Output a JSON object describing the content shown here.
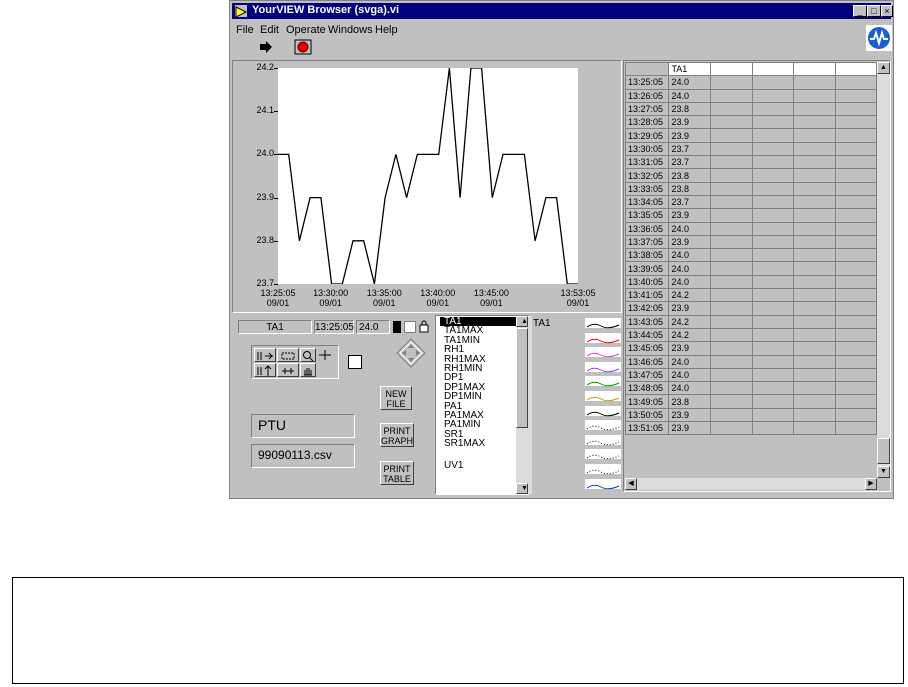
{
  "window": {
    "title": "YourVIEW Browser (svga).vi",
    "controls": [
      "minimize-icon",
      "maximize-icon",
      "close-icon"
    ]
  },
  "menu": [
    "File",
    "Edit",
    "Operate",
    "Windows",
    "Help"
  ],
  "toolbar": {
    "run_icon": "run-arrow-icon",
    "stop_icon": "stop-icon",
    "logo_icon": "vi-logo-icon"
  },
  "chart_data": {
    "type": "line",
    "ylim": [
      23.7,
      24.2
    ],
    "yticks": [
      "24.2",
      "24.1",
      "24.0",
      "23.9",
      "23.8",
      "23.7"
    ],
    "xticks": [
      {
        "time": "13:25:05",
        "date": "09/01"
      },
      {
        "time": "13:30:00",
        "date": "09/01"
      },
      {
        "time": "13:35:00",
        "date": "09/01"
      },
      {
        "time": "13:40:00",
        "date": "09/01"
      },
      {
        "time": "13:45:00",
        "date": "09/01"
      },
      {
        "time": "13:53:05",
        "date": "09/01"
      }
    ],
    "x": [
      "13:25:05",
      "13:26:05",
      "13:27:05",
      "13:28:05",
      "13:29:05",
      "13:30:05",
      "13:31:05",
      "13:32:05",
      "13:33:05",
      "13:34:05",
      "13:35:05",
      "13:36:05",
      "13:37:05",
      "13:38:05",
      "13:39:05",
      "13:40:05",
      "13:41:05",
      "13:42:05",
      "13:43:05",
      "13:44:05",
      "13:45:05",
      "13:46:05",
      "13:47:05",
      "13:48:05",
      "13:49:05",
      "13:50:05",
      "13:51:05",
      "13:52:05",
      "13:53:05"
    ],
    "series": [
      {
        "name": "TA1",
        "values": [
          24.0,
          24.0,
          23.8,
          23.9,
          23.9,
          23.7,
          23.7,
          23.8,
          23.8,
          23.7,
          23.9,
          24.0,
          23.9,
          24.0,
          24.0,
          24.0,
          24.2,
          23.9,
          24.2,
          24.2,
          23.9,
          24.0,
          24.0,
          24.0,
          23.8,
          23.9,
          23.9,
          23.7,
          23.7
        ]
      }
    ]
  },
  "cursor": {
    "channel": "TA1",
    "time": "13:25:05",
    "value": "24.0"
  },
  "tools": [
    "zoom-x-icon",
    "zoom-y-icon",
    "zoom-icon",
    "crosshair-icon",
    "pan-icon",
    "hand-icon"
  ],
  "buttons": {
    "new_file": [
      "NEW",
      "FILE"
    ],
    "print_graph": [
      "PRINT",
      "GRAPH"
    ],
    "print_table": [
      "PRINT",
      "TABLE"
    ]
  },
  "fields": {
    "name": "PTU",
    "file": "99090113.csv"
  },
  "channels": [
    "TA1",
    "TA1MAX",
    "TA1MIN",
    "RH1",
    "RH1MAX",
    "RH1MIN",
    "DP1",
    "DP1MAX",
    "DP1MIN",
    "PA1",
    "PA1MAX",
    "PA1MIN",
    "SR1",
    "SR1MAX",
    "",
    "UV1"
  ],
  "legend": {
    "label": "TA1",
    "swatches": [
      {
        "color": "#000000",
        "style": "solid"
      },
      {
        "color": "#ff0000",
        "style": "solid"
      },
      {
        "color": "#cc44cc",
        "style": "solid"
      },
      {
        "color": "#8844ff",
        "style": "solid"
      },
      {
        "color": "#009900",
        "style": "solid"
      },
      {
        "color": "#cc9900",
        "style": "solid"
      },
      {
        "color": "#000000",
        "style": "solid"
      },
      {
        "color": "#000000",
        "style": "dotted"
      },
      {
        "color": "#000000",
        "style": "dotted"
      },
      {
        "color": "#000000",
        "style": "dotted"
      },
      {
        "color": "#000000",
        "style": "dotted"
      },
      {
        "color": "#0044cc",
        "style": "solid"
      }
    ]
  },
  "table": {
    "header": [
      "",
      "TA1",
      "",
      "",
      "",
      ""
    ],
    "rows": [
      [
        "13:25:05",
        "24.0"
      ],
      [
        "13:26:05",
        "24.0"
      ],
      [
        "13:27:05",
        "23.8"
      ],
      [
        "13:28:05",
        "23.9"
      ],
      [
        "13:29:05",
        "23.9"
      ],
      [
        "13:30:05",
        "23.7"
      ],
      [
        "13:31:05",
        "23.7"
      ],
      [
        "13:32:05",
        "23.8"
      ],
      [
        "13:33:05",
        "23.8"
      ],
      [
        "13:34:05",
        "23.7"
      ],
      [
        "13:35:05",
        "23.9"
      ],
      [
        "13:36:05",
        "24.0"
      ],
      [
        "13:37:05",
        "23.9"
      ],
      [
        "13:38:05",
        "24.0"
      ],
      [
        "13:39:05",
        "24.0"
      ],
      [
        "13:40:05",
        "24.0"
      ],
      [
        "13:41:05",
        "24.2"
      ],
      [
        "13:42:05",
        "23.9"
      ],
      [
        "13:43:05",
        "24.2"
      ],
      [
        "13:44:05",
        "24.2"
      ],
      [
        "13:45:05",
        "23.9"
      ],
      [
        "13:46:05",
        "24.0"
      ],
      [
        "13:47:05",
        "24.0"
      ],
      [
        "13:48:05",
        "24.0"
      ],
      [
        "13:49:05",
        "23.8"
      ],
      [
        "13:50:05",
        "23.9"
      ],
      [
        "13:51:05",
        "23.9"
      ]
    ]
  }
}
